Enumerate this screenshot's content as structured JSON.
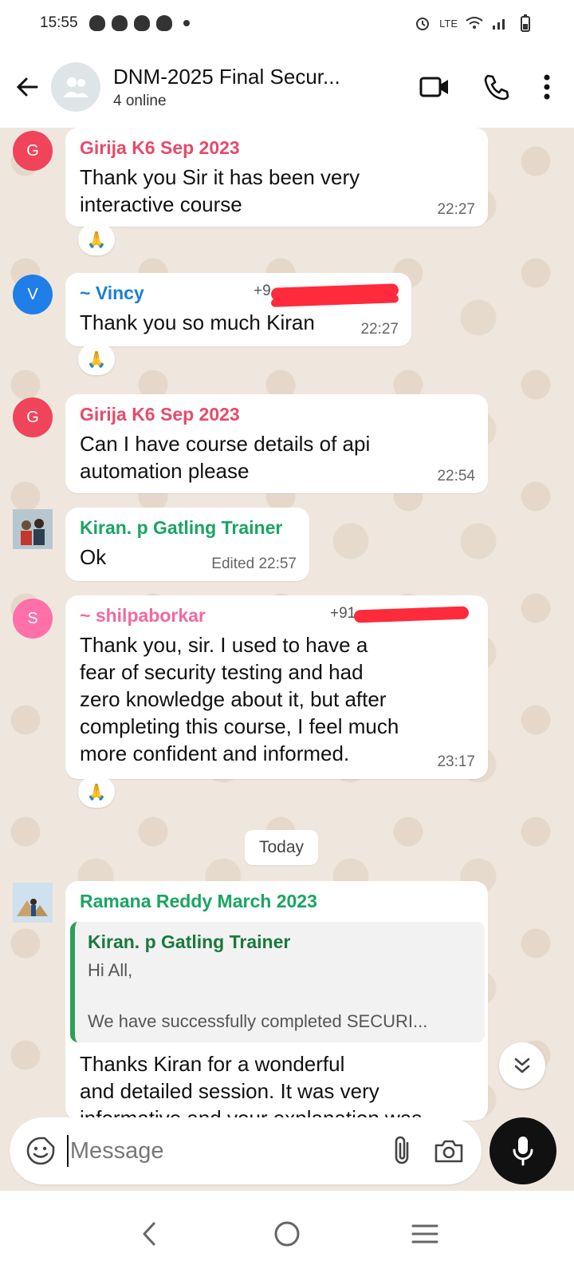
{
  "status": {
    "time": "15:55",
    "network": "LTE"
  },
  "header": {
    "title": "DNM-2025 Final Secur...",
    "subtitle": "4 online"
  },
  "messages": [
    {
      "sender": "Girija K6 Sep 2023",
      "avatar_letter": "G",
      "avatar_color": "#f0445a",
      "sender_color": "#e84a6a",
      "text": "Thank you Sir it has been very\ninteractive course",
      "time": "22:27",
      "reaction": "🙏"
    },
    {
      "sender": "~ Vincy",
      "avatar_letter": "V",
      "avatar_color": "#1f7ee8",
      "sender_color": "#1a7fd6",
      "phone": "+9",
      "text": "Thank you so much Kiran",
      "time": "22:27",
      "reaction": "🙏"
    },
    {
      "sender": "Girija K6 Sep 2023",
      "avatar_letter": "G",
      "avatar_color": "#f0445a",
      "sender_color": "#e84a6a",
      "text": "Can I have course details of api\nautomation please",
      "time": "22:54"
    },
    {
      "sender": "Kiran. p Gatling Trainer",
      "sender_color": "#1aa563",
      "text": "Ok",
      "time": "Edited 22:57"
    },
    {
      "sender": "~ shilpaborkar",
      "avatar_letter": "S",
      "avatar_color": "#ff6fa8",
      "sender_color": "#f06aa0",
      "phone": "+91",
      "text": "Thank you, sir. I used to have a\nfear of security testing and had\nzero knowledge about it, but after\ncompleting this course, I feel much\nmore confident and informed.",
      "time": "23:17",
      "reaction": "🙏"
    },
    {
      "sender": "Ramana Reddy March 2023",
      "sender_color": "#1aa563",
      "quote": {
        "sender": "Kiran. p Gatling Trainer",
        "text": "Hi All,\n\nWe have successfully completed SECURI..."
      },
      "text": "Thanks Kiran for a wonderful\nand detailed session. It was very\ninformative and your explanation was"
    }
  ],
  "date_chip": "Today",
  "composer": {
    "placeholder": "Message"
  }
}
